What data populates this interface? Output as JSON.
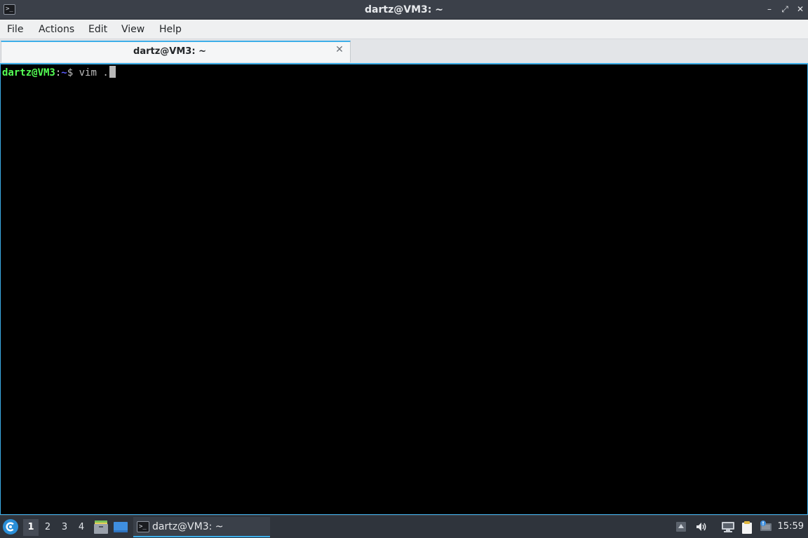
{
  "window": {
    "title": "dartz@VM3: ~",
    "icon": "terminal-icon",
    "icon_glyph": ">_",
    "controls": {
      "minimize": "–",
      "maximize": "⤢",
      "close": "✕"
    }
  },
  "menubar": {
    "items": [
      {
        "label": "File"
      },
      {
        "label": "Actions"
      },
      {
        "label": "Edit"
      },
      {
        "label": "View"
      },
      {
        "label": "Help"
      }
    ]
  },
  "tabs": [
    {
      "label": "dartz@VM3: ~",
      "active": true,
      "close": "✕"
    }
  ],
  "terminal": {
    "background": "#000000",
    "prompt_user": "dartz@VM3",
    "prompt_colon": ":",
    "prompt_path": "~",
    "prompt_dollar": "$",
    "command": " vim ."
  },
  "taskbar": {
    "start_icon": "app-menu-icon",
    "desktops": [
      "1",
      "2",
      "3",
      "4"
    ],
    "active_desktop": "1",
    "quicklaunch": [
      "file-manager-icon",
      "show-desktop-icon"
    ],
    "tasks": [
      {
        "label": "dartz@VM3: ~",
        "icon": "terminal-icon",
        "icon_glyph": ">_"
      }
    ],
    "tray": [
      "tray-expand-icon",
      "volume-icon",
      "network-icon",
      "clipboard-icon",
      "update-notifier-icon"
    ],
    "clock": "15:59"
  },
  "colors": {
    "accent": "#3daee9",
    "prompt_user": "#54ff54",
    "prompt_path": "#5c5cff",
    "taskbar_bg": "#2f343c",
    "titlebar_bg": "#3b4049"
  }
}
